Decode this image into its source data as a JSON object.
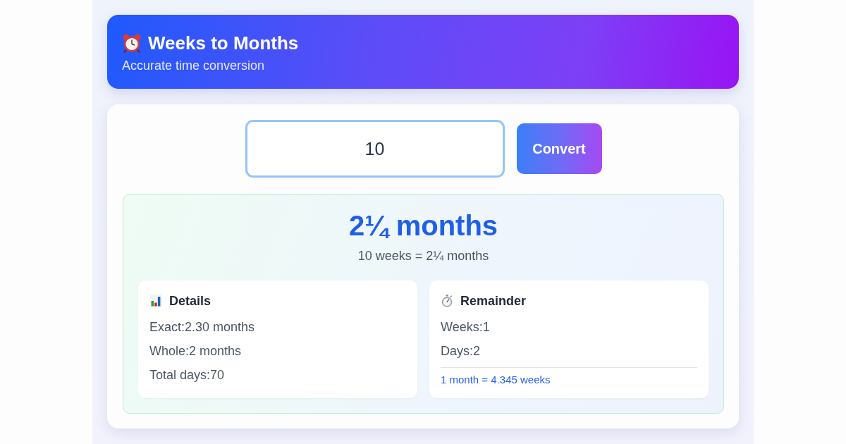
{
  "header": {
    "title": "Weeks to Months",
    "subtitle": "Accurate time conversion"
  },
  "converter": {
    "input": {
      "value": "10"
    },
    "button": "Convert"
  },
  "result": {
    "headline": "2¼ months",
    "equation": "10 weeks = 2¼ months",
    "cards": [
      {
        "title": "Details",
        "lines": [
          "Exact:2.30 months",
          "Whole:2 months",
          "Total days:70"
        ]
      },
      {
        "title": "Remainder",
        "lines": [
          "Weeks:1",
          "Days:2"
        ],
        "note": "1 month = 4.345 weeks"
      }
    ]
  }
}
